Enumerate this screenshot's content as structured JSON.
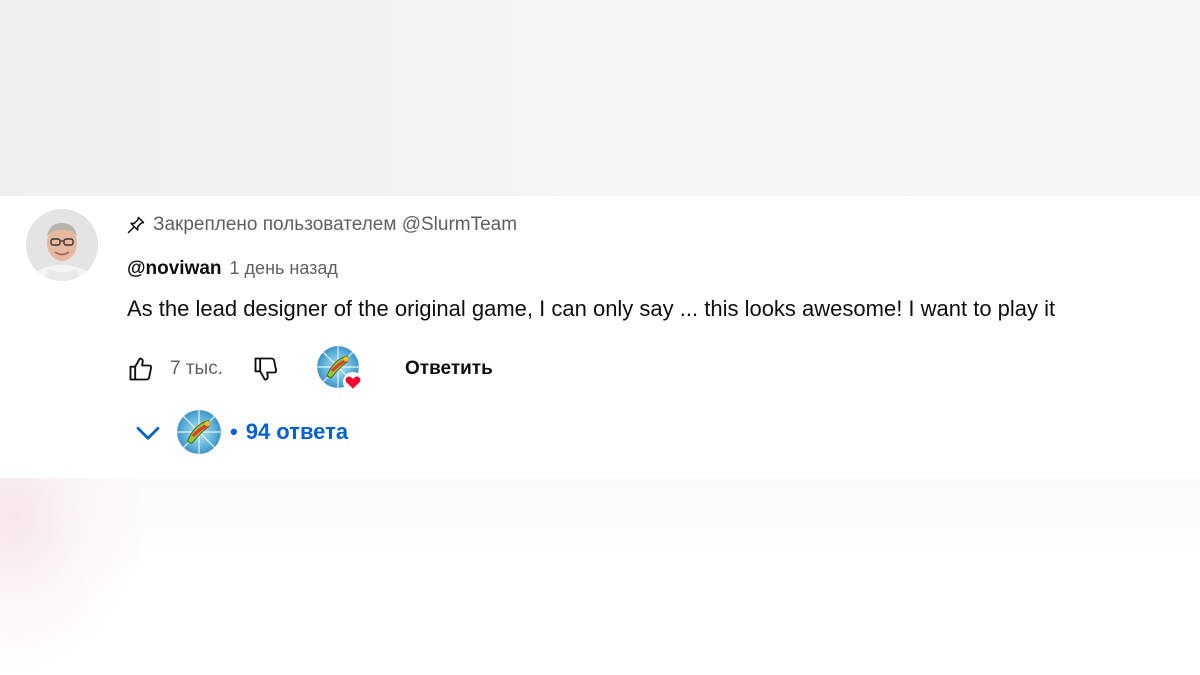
{
  "comment": {
    "pinned_label": "Закреплено пользователем @SlurmTeam",
    "author": "@noviwan",
    "timestamp": "1 день назад",
    "text": "As the lead designer of the original game, I can only say ... this looks awesome! I want to play it",
    "like_count": "7 тыс.",
    "reply_label": "Ответить",
    "replies_label": "94 ответа",
    "separator": "•"
  },
  "icons": {
    "pin": "pin-icon",
    "like": "thumbs-up-icon",
    "dislike": "thumbs-down-icon",
    "heart": "heart-icon",
    "expand": "chevron-down-icon"
  },
  "colors": {
    "link_blue": "#065fd4",
    "heart_red": "#ff0033",
    "secondary_text": "#606060"
  }
}
